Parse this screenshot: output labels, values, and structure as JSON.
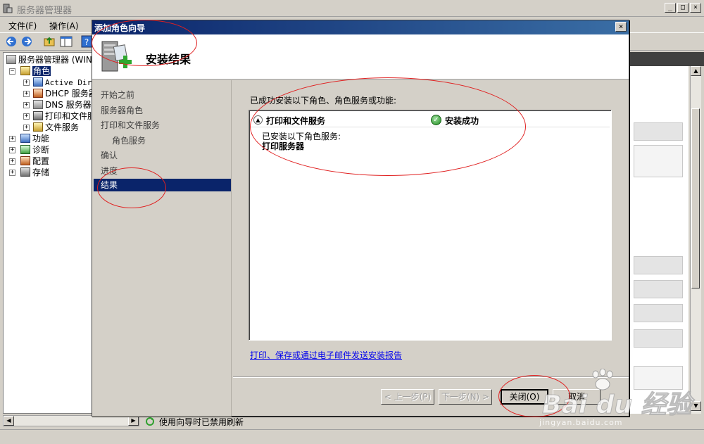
{
  "main_window": {
    "title": "服务器管理器",
    "controls": {
      "minimize": "_",
      "maximize": "□",
      "close": "×"
    }
  },
  "menu": {
    "items": [
      {
        "label": "文件(F)"
      },
      {
        "label": "操作(A)"
      }
    ]
  },
  "toolbar": {
    "icons": [
      "back-arrow-icon",
      "forward-arrow-icon",
      "up-folder-icon",
      "show-hide-tree-icon",
      "help-icon"
    ]
  },
  "tree": {
    "root": {
      "label": "服务器管理器 (WIN"
    },
    "roles": {
      "label": "角色",
      "expander": "−"
    },
    "role_items": [
      {
        "label": "Active Dire",
        "expander": "+"
      },
      {
        "label": "DHCP 服务器",
        "expander": "+"
      },
      {
        "label": "DNS 服务器",
        "expander": "+"
      },
      {
        "label": "打印和文件服",
        "expander": "+"
      },
      {
        "label": "文件服务",
        "expander": "+"
      }
    ],
    "top_items": [
      {
        "label": "功能",
        "expander": "+"
      },
      {
        "label": "诊断",
        "expander": "+"
      },
      {
        "label": "配置",
        "expander": "+"
      },
      {
        "label": "存储",
        "expander": "+"
      }
    ]
  },
  "status_bar": {
    "text": "使用向导时已禁用刷新"
  },
  "wizard": {
    "title": "添加角色向导",
    "close": "×",
    "heading": "安装结果",
    "nav": [
      {
        "label": "开始之前"
      },
      {
        "label": "服务器角色"
      },
      {
        "label": "打印和文件服务"
      },
      {
        "label": "角色服务"
      },
      {
        "label": "确认"
      },
      {
        "label": "进度"
      },
      {
        "label": "结果"
      }
    ],
    "intro": "已成功安装以下角色、角色服务或功能:",
    "result": {
      "collapse": "▲",
      "name": "打印和文件服务",
      "status_icon": "check-icon",
      "status_check": "✓",
      "status": "安装成功",
      "detail": "已安装以下角色服务:",
      "service": "打印服务器"
    },
    "report_link": "打印、保存或通过电子邮件发送安装报告",
    "buttons": {
      "prev": "< 上一步(P)",
      "next": "下一步(N) >",
      "close": "关闭(O)",
      "cancel": "取消"
    }
  },
  "watermark": {
    "logo": "Bai du 经验",
    "sub": "jingyan.baidu.com"
  },
  "colors": {
    "title_active_start": "#0a246a",
    "title_active_end": "#3a6ea5",
    "selection": "#0a246a",
    "annotation": "#e02020",
    "link": "#0000ee"
  }
}
